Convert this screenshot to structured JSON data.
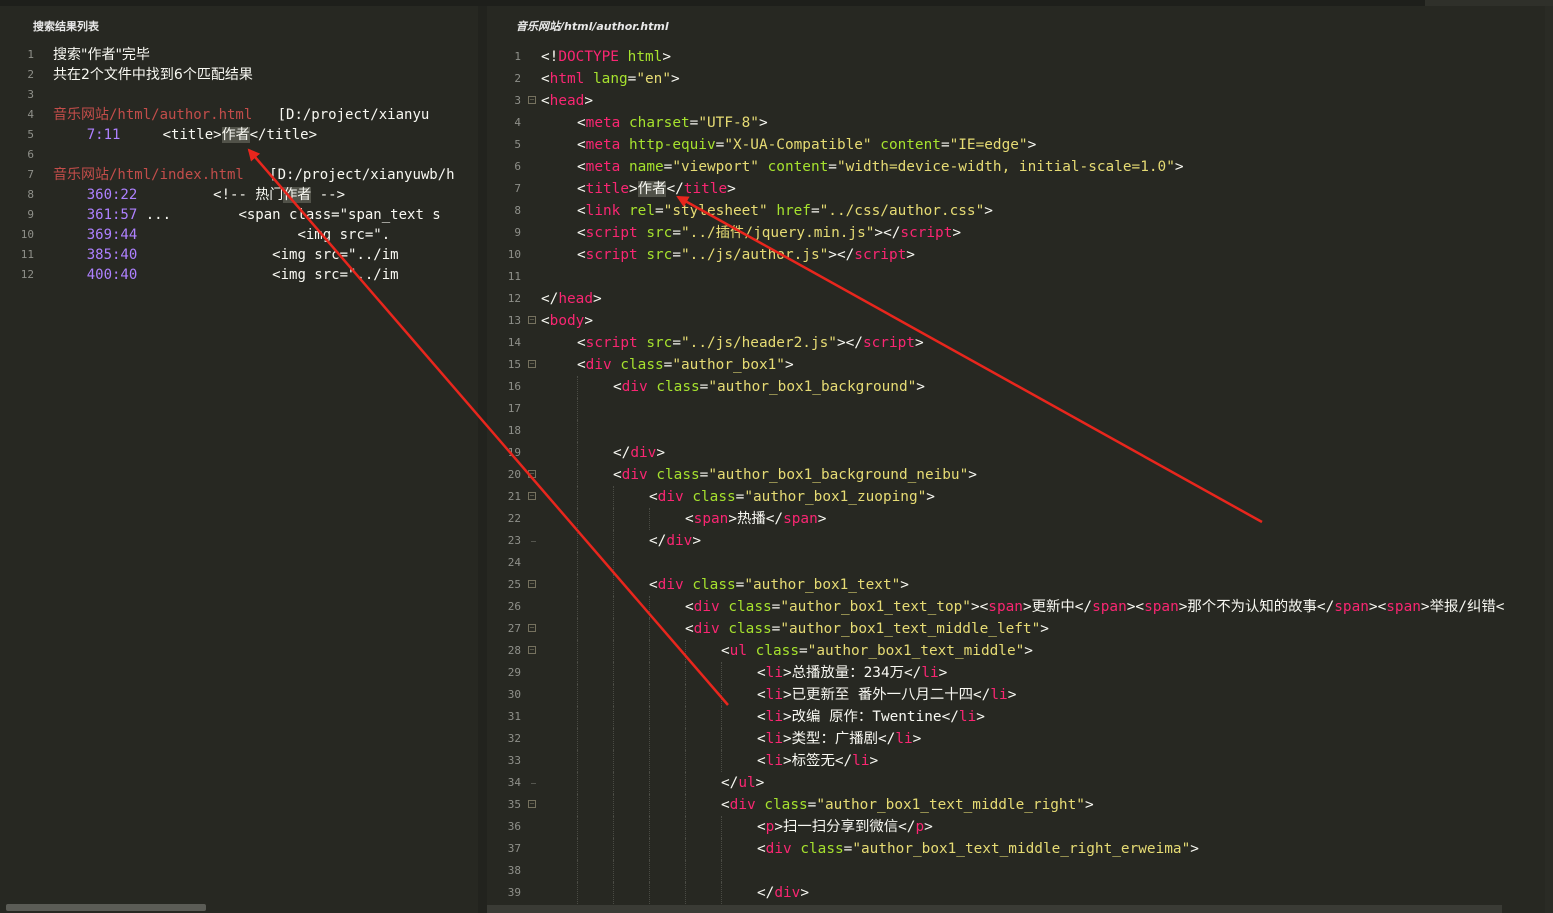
{
  "search_panel": {
    "title": "搜索结果列表",
    "lines": [
      {
        "n": "1",
        "text": "搜索\"作者\"完毕"
      },
      {
        "n": "2",
        "text": "共在2个文件中找到6个匹配结果"
      },
      {
        "n": "3"
      },
      {
        "n": "4",
        "file": "音乐网站/html/author.html",
        "path": "[D:/project/xianyu"
      },
      {
        "n": "5",
        "loc": "7:11",
        "pre": "<title>",
        "hit": "作者",
        "post": "</title>"
      },
      {
        "n": "6"
      },
      {
        "n": "7",
        "file": "音乐网站/html/index.html",
        "path": "[D:/project/xianyuwb/h"
      },
      {
        "n": "8",
        "loc": "360:22",
        "pre": "<!-- 热门",
        "hit": "作者",
        "post": " -->"
      },
      {
        "n": "9",
        "loc": "361:57",
        "pre": "...        <span class=\"span_text s"
      },
      {
        "n": "10",
        "loc": "369:44",
        "pre": "<img src=\"."
      },
      {
        "n": "11",
        "loc": "385:40",
        "pre": "<img src=\"../im"
      },
      {
        "n": "12",
        "loc": "400:40",
        "pre": "<img src=\"../im"
      }
    ]
  },
  "editor": {
    "tab_title": "音乐网站/html/author.html",
    "lines": [
      {
        "n": "1",
        "ind": 0,
        "parts": [
          [
            "p",
            "<!"
          ],
          [
            "t",
            "DOCTYPE"
          ],
          [
            "p",
            " "
          ],
          [
            "a",
            "html"
          ],
          [
            "p",
            ">"
          ]
        ]
      },
      {
        "n": "2",
        "ind": 0,
        "parts": [
          [
            "p",
            "<"
          ],
          [
            "t",
            "html"
          ],
          [
            "p",
            " "
          ],
          [
            "a",
            "lang"
          ],
          [
            "p",
            "="
          ],
          [
            "s",
            "\"en\""
          ],
          [
            "p",
            ">"
          ]
        ]
      },
      {
        "n": "3",
        "ind": 0,
        "fold": true,
        "parts": [
          [
            "p",
            "<"
          ],
          [
            "t",
            "head"
          ],
          [
            "p",
            ">"
          ]
        ]
      },
      {
        "n": "4",
        "ind": 1,
        "parts": [
          [
            "p",
            "<"
          ],
          [
            "t",
            "meta"
          ],
          [
            "p",
            " "
          ],
          [
            "a",
            "charset"
          ],
          [
            "p",
            "="
          ],
          [
            "s",
            "\"UTF-8\""
          ],
          [
            "p",
            ">"
          ]
        ]
      },
      {
        "n": "5",
        "ind": 1,
        "parts": [
          [
            "p",
            "<"
          ],
          [
            "t",
            "meta"
          ],
          [
            "p",
            " "
          ],
          [
            "a",
            "http-equiv"
          ],
          [
            "p",
            "="
          ],
          [
            "s",
            "\"X-UA-Compatible\""
          ],
          [
            "p",
            " "
          ],
          [
            "a",
            "content"
          ],
          [
            "p",
            "="
          ],
          [
            "s",
            "\"IE=edge\""
          ],
          [
            "p",
            ">"
          ]
        ]
      },
      {
        "n": "6",
        "ind": 1,
        "parts": [
          [
            "p",
            "<"
          ],
          [
            "t",
            "meta"
          ],
          [
            "p",
            " "
          ],
          [
            "a",
            "name"
          ],
          [
            "p",
            "="
          ],
          [
            "s",
            "\"viewport\""
          ],
          [
            "p",
            " "
          ],
          [
            "a",
            "content"
          ],
          [
            "p",
            "="
          ],
          [
            "s",
            "\"width=device-width, initial-scale=1.0\""
          ],
          [
            "p",
            ">"
          ]
        ]
      },
      {
        "n": "7",
        "ind": 1,
        "parts": [
          [
            "p",
            "<"
          ],
          [
            "t",
            "title"
          ],
          [
            "p",
            ">"
          ],
          [
            "hl",
            "作者"
          ],
          [
            "p",
            "</"
          ],
          [
            "t",
            "title"
          ],
          [
            "p",
            ">"
          ]
        ]
      },
      {
        "n": "8",
        "ind": 1,
        "parts": [
          [
            "p",
            "<"
          ],
          [
            "t",
            "link"
          ],
          [
            "p",
            " "
          ],
          [
            "a",
            "rel"
          ],
          [
            "p",
            "="
          ],
          [
            "s",
            "\"stylesheet\""
          ],
          [
            "p",
            " "
          ],
          [
            "a",
            "href"
          ],
          [
            "p",
            "="
          ],
          [
            "s",
            "\"../css/author.css\""
          ],
          [
            "p",
            ">"
          ]
        ]
      },
      {
        "n": "9",
        "ind": 1,
        "parts": [
          [
            "p",
            "<"
          ],
          [
            "t",
            "script"
          ],
          [
            "p",
            " "
          ],
          [
            "a",
            "src"
          ],
          [
            "p",
            "="
          ],
          [
            "s",
            "\"../插件/jquery.min.js\""
          ],
          [
            "p",
            "></"
          ],
          [
            "t",
            "script"
          ],
          [
            "p",
            ">"
          ]
        ]
      },
      {
        "n": "10",
        "ind": 1,
        "parts": [
          [
            "p",
            "<"
          ],
          [
            "t",
            "script"
          ],
          [
            "p",
            " "
          ],
          [
            "a",
            "src"
          ],
          [
            "p",
            "="
          ],
          [
            "s",
            "\"../js/author.js\""
          ],
          [
            "p",
            "></"
          ],
          [
            "t",
            "script"
          ],
          [
            "p",
            ">"
          ]
        ]
      },
      {
        "n": "11",
        "ind": 0,
        "parts": []
      },
      {
        "n": "12",
        "ind": 0,
        "parts": [
          [
            "p",
            "</"
          ],
          [
            "t",
            "head"
          ],
          [
            "p",
            ">"
          ]
        ]
      },
      {
        "n": "13",
        "ind": 0,
        "fold": true,
        "parts": [
          [
            "p",
            "<"
          ],
          [
            "t",
            "body"
          ],
          [
            "p",
            ">"
          ]
        ]
      },
      {
        "n": "14",
        "ind": 1,
        "parts": [
          [
            "p",
            "<"
          ],
          [
            "t",
            "script"
          ],
          [
            "p",
            " "
          ],
          [
            "a",
            "src"
          ],
          [
            "p",
            "="
          ],
          [
            "s",
            "\"../js/header2.js\""
          ],
          [
            "p",
            "></"
          ],
          [
            "t",
            "script"
          ],
          [
            "p",
            ">"
          ]
        ]
      },
      {
        "n": "15",
        "ind": 1,
        "fold": true,
        "parts": [
          [
            "p",
            "<"
          ],
          [
            "t",
            "div"
          ],
          [
            "p",
            " "
          ],
          [
            "a",
            "class"
          ],
          [
            "p",
            "="
          ],
          [
            "s",
            "\"author_box1\""
          ],
          [
            "p",
            ">"
          ]
        ]
      },
      {
        "n": "16",
        "ind": 2,
        "parts": [
          [
            "p",
            "<"
          ],
          [
            "t",
            "div"
          ],
          [
            "p",
            " "
          ],
          [
            "a",
            "class"
          ],
          [
            "p",
            "="
          ],
          [
            "s",
            "\"author_box1_background\""
          ],
          [
            "p",
            ">"
          ]
        ]
      },
      {
        "n": "17",
        "ind": 2,
        "parts": []
      },
      {
        "n": "18",
        "ind": 2,
        "parts": []
      },
      {
        "n": "19",
        "ind": 2,
        "parts": [
          [
            "p",
            "</"
          ],
          [
            "t",
            "div"
          ],
          [
            "p",
            ">"
          ]
        ]
      },
      {
        "n": "20",
        "ind": 2,
        "fold": true,
        "parts": [
          [
            "p",
            "<"
          ],
          [
            "t",
            "div"
          ],
          [
            "p",
            " "
          ],
          [
            "a",
            "class"
          ],
          [
            "p",
            "="
          ],
          [
            "s",
            "\"author_box1_background_neibu\""
          ],
          [
            "p",
            ">"
          ]
        ]
      },
      {
        "n": "21",
        "ind": 3,
        "fold": true,
        "parts": [
          [
            "p",
            "<"
          ],
          [
            "t",
            "div"
          ],
          [
            "p",
            " "
          ],
          [
            "a",
            "class"
          ],
          [
            "p",
            "="
          ],
          [
            "s",
            "\"author_box1_zuoping\""
          ],
          [
            "p",
            ">"
          ]
        ]
      },
      {
        "n": "22",
        "ind": 4,
        "parts": [
          [
            "p",
            "<"
          ],
          [
            "t",
            "span"
          ],
          [
            "p",
            ">热播</"
          ],
          [
            "t",
            "span"
          ],
          [
            "p",
            ">"
          ]
        ]
      },
      {
        "n": "23",
        "ind": 3,
        "foldend": true,
        "parts": [
          [
            "p",
            "</"
          ],
          [
            "t",
            "div"
          ],
          [
            "p",
            ">"
          ]
        ]
      },
      {
        "n": "24",
        "ind": 3,
        "parts": []
      },
      {
        "n": "25",
        "ind": 3,
        "fold": true,
        "parts": [
          [
            "p",
            "<"
          ],
          [
            "t",
            "div"
          ],
          [
            "p",
            " "
          ],
          [
            "a",
            "class"
          ],
          [
            "p",
            "="
          ],
          [
            "s",
            "\"author_box1_text\""
          ],
          [
            "p",
            ">"
          ]
        ]
      },
      {
        "n": "26",
        "ind": 4,
        "parts": [
          [
            "p",
            "<"
          ],
          [
            "t",
            "div"
          ],
          [
            "p",
            " "
          ],
          [
            "a",
            "class"
          ],
          [
            "p",
            "="
          ],
          [
            "s",
            "\"author_box1_text_top\""
          ],
          [
            "p",
            "><"
          ],
          [
            "t",
            "span"
          ],
          [
            "p",
            ">更新中</"
          ],
          [
            "t",
            "span"
          ],
          [
            "p",
            "><"
          ],
          [
            "t",
            "span"
          ],
          [
            "p",
            ">那个不为认知的故事</"
          ],
          [
            "t",
            "span"
          ],
          [
            "p",
            "><"
          ],
          [
            "t",
            "span"
          ],
          [
            "p",
            ">举报/纠错<"
          ]
        ]
      },
      {
        "n": "27",
        "ind": 4,
        "fold": true,
        "parts": [
          [
            "p",
            "<"
          ],
          [
            "t",
            "div"
          ],
          [
            "p",
            " "
          ],
          [
            "a",
            "class"
          ],
          [
            "p",
            "="
          ],
          [
            "s",
            "\"author_box1_text_middle_left\""
          ],
          [
            "p",
            ">"
          ]
        ]
      },
      {
        "n": "28",
        "ind": 5,
        "fold": true,
        "parts": [
          [
            "p",
            "<"
          ],
          [
            "t",
            "ul"
          ],
          [
            "p",
            " "
          ],
          [
            "a",
            "class"
          ],
          [
            "p",
            "="
          ],
          [
            "s",
            "\"author_box1_text_middle\""
          ],
          [
            "p",
            ">"
          ]
        ]
      },
      {
        "n": "29",
        "ind": 6,
        "parts": [
          [
            "p",
            "<"
          ],
          [
            "t",
            "li"
          ],
          [
            "p",
            ">总播放量：234万</"
          ],
          [
            "t",
            "li"
          ],
          [
            "p",
            ">"
          ]
        ]
      },
      {
        "n": "30",
        "ind": 6,
        "parts": [
          [
            "p",
            "<"
          ],
          [
            "t",
            "li"
          ],
          [
            "p",
            ">已更新至 番外一八月二十四</"
          ],
          [
            "t",
            "li"
          ],
          [
            "p",
            ">"
          ]
        ]
      },
      {
        "n": "31",
        "ind": 6,
        "parts": [
          [
            "p",
            "<"
          ],
          [
            "t",
            "li"
          ],
          [
            "p",
            ">改编 原作：Twentine</"
          ],
          [
            "t",
            "li"
          ],
          [
            "p",
            ">"
          ]
        ]
      },
      {
        "n": "32",
        "ind": 6,
        "parts": [
          [
            "p",
            "<"
          ],
          [
            "t",
            "li"
          ],
          [
            "p",
            ">类型：广播剧</"
          ],
          [
            "t",
            "li"
          ],
          [
            "p",
            ">"
          ]
        ]
      },
      {
        "n": "33",
        "ind": 6,
        "parts": [
          [
            "p",
            "<"
          ],
          [
            "t",
            "li"
          ],
          [
            "p",
            ">标签无</"
          ],
          [
            "t",
            "li"
          ],
          [
            "p",
            ">"
          ]
        ]
      },
      {
        "n": "34",
        "ind": 5,
        "foldend": true,
        "parts": [
          [
            "p",
            "</"
          ],
          [
            "t",
            "ul"
          ],
          [
            "p",
            ">"
          ]
        ]
      },
      {
        "n": "35",
        "ind": 5,
        "fold": true,
        "parts": [
          [
            "p",
            "<"
          ],
          [
            "t",
            "div"
          ],
          [
            "p",
            " "
          ],
          [
            "a",
            "class"
          ],
          [
            "p",
            "="
          ],
          [
            "s",
            "\"author_box1_text_middle_right\""
          ],
          [
            "p",
            ">"
          ]
        ]
      },
      {
        "n": "36",
        "ind": 6,
        "parts": [
          [
            "p",
            "<"
          ],
          [
            "t",
            "p"
          ],
          [
            "p",
            ">扫一扫分享到微信</"
          ],
          [
            "t",
            "p"
          ],
          [
            "p",
            ">"
          ]
        ]
      },
      {
        "n": "37",
        "ind": 6,
        "parts": [
          [
            "p",
            "<"
          ],
          [
            "t",
            "div"
          ],
          [
            "p",
            " "
          ],
          [
            "a",
            "class"
          ],
          [
            "p",
            "="
          ],
          [
            "s",
            "\"author_box1_text_middle_right_erweima\""
          ],
          [
            "p",
            ">"
          ]
        ]
      },
      {
        "n": "38",
        "ind": 6,
        "parts": []
      },
      {
        "n": "39",
        "ind": 6,
        "parts": [
          [
            "p",
            "</"
          ],
          [
            "t",
            "div"
          ],
          [
            "p",
            ">"
          ]
        ]
      }
    ]
  },
  "colors": {
    "background": "#272822",
    "tag": "#f92672",
    "attribute": "#a6e22e",
    "string": "#e6db74",
    "line_col": "#ae81ff",
    "file_name": "#c24d4a",
    "annotation_arrow": "#e8261d"
  }
}
